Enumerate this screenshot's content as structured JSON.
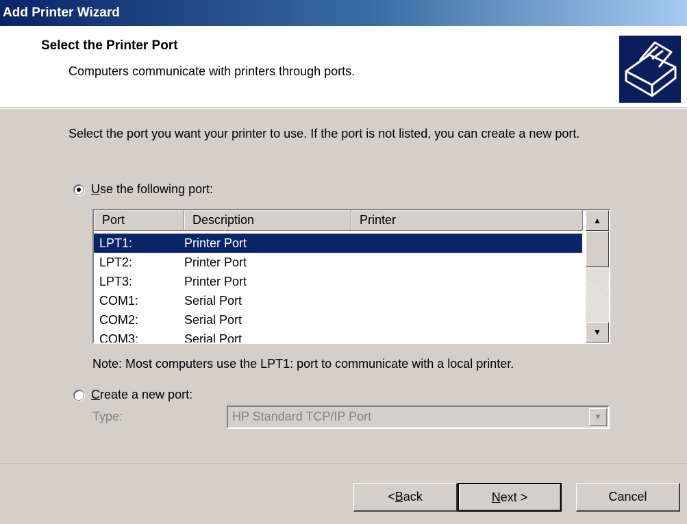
{
  "window": {
    "title": "Add Printer Wizard"
  },
  "header": {
    "title": "Select the Printer Port",
    "subtitle": "Computers communicate with printers through ports."
  },
  "intro": "Select the port you want your printer to use.  If the port is not listed, you can create a new port.",
  "option_existing": {
    "label_key": "U",
    "label_rest": "se the following port:",
    "checked": true
  },
  "option_new": {
    "label_key": "C",
    "label_rest": "reate a new port:",
    "checked": false
  },
  "port_list": {
    "columns": [
      "Port",
      "Description",
      "Printer"
    ],
    "rows": [
      {
        "port": "LPT1:",
        "description": "Printer Port",
        "printer": "",
        "selected": true
      },
      {
        "port": "LPT2:",
        "description": "Printer Port",
        "printer": ""
      },
      {
        "port": "LPT3:",
        "description": "Printer Port",
        "printer": ""
      },
      {
        "port": "COM1:",
        "description": "Serial Port",
        "printer": ""
      },
      {
        "port": "COM2:",
        "description": "Serial Port",
        "printer": ""
      },
      {
        "port": "COM3:",
        "description": "Serial Port",
        "printer": ""
      }
    ]
  },
  "note": "Note: Most computers use the LPT1: port to communicate with a local printer.",
  "type_label": "Type:",
  "type_value": "HP Standard TCP/IP Port",
  "buttons": {
    "back_key": "B",
    "back_prefix": "< ",
    "back_rest": "ack",
    "next_key": "N",
    "next_rest": "ext >",
    "cancel": "Cancel"
  },
  "icons": {
    "header": "printer-icon",
    "scroll_up": "scroll-up-arrow-icon",
    "scroll_down": "scroll-down-arrow-icon",
    "combo": "dropdown-arrow-icon"
  }
}
